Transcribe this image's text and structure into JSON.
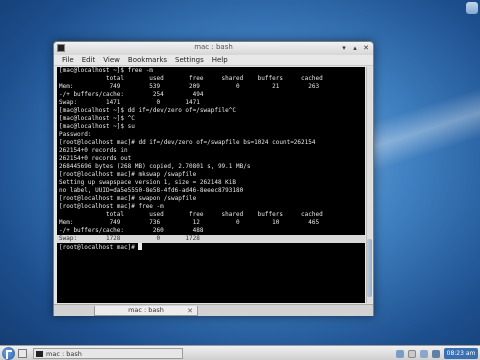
{
  "desktop": {
    "accent": "#3f7fc0"
  },
  "window": {
    "title": "mac : bash",
    "controls": [
      "▾",
      "▴",
      "✕"
    ]
  },
  "menubar": {
    "items": [
      "File",
      "Edit",
      "View",
      "Bookmarks",
      "Settings",
      "Help"
    ]
  },
  "terminal": {
    "lines": [
      "[mac@localhost ~]$ free -m",
      "             total       used       free     shared    buffers     cached",
      "Mem:          749        539        209          0         21        263",
      "-/+ buffers/cache:        254        494",
      "Swap:        1471          0       1471",
      "[mac@localhost ~]$ dd if=/dev/zero of=/swapfile^C",
      "[mac@localhost ~]$ ^C",
      "[mac@localhost ~]$ su",
      "Password:",
      "[root@localhost mac]# dd if=/dev/zero of=/swapfile bs=1024 count=262154",
      "262154+0 records in",
      "262154+0 records out",
      "268445696 bytes (268 MB) copied, 2.70801 s, 99.1 MB/s",
      "[root@localhost mac]# mkswap /swapfile",
      "Setting up swapspace version 1, size = 262148 KiB",
      "no label, UUID=da5e5550-8e58-4fd6-ad46-8eeec8793180",
      "[root@localhost mac]# swapon /swapfile",
      "[root@localhost mac]# free -m",
      "             total       used       free     shared    buffers     cached",
      "Mem:          749        736         12          0         10        465",
      "-/+ buffers/cache:        260        488",
      "Swap:        1728          0       1728",
      "[root@localhost mac]# "
    ],
    "highlighted_line": 21
  },
  "tabbar": {
    "tab_label": "mac : bash",
    "close_glyph": "✕"
  },
  "taskbar": {
    "task_label": "mac : bash",
    "clock": "08:23 am",
    "clock_color": "#3a6fb2"
  }
}
